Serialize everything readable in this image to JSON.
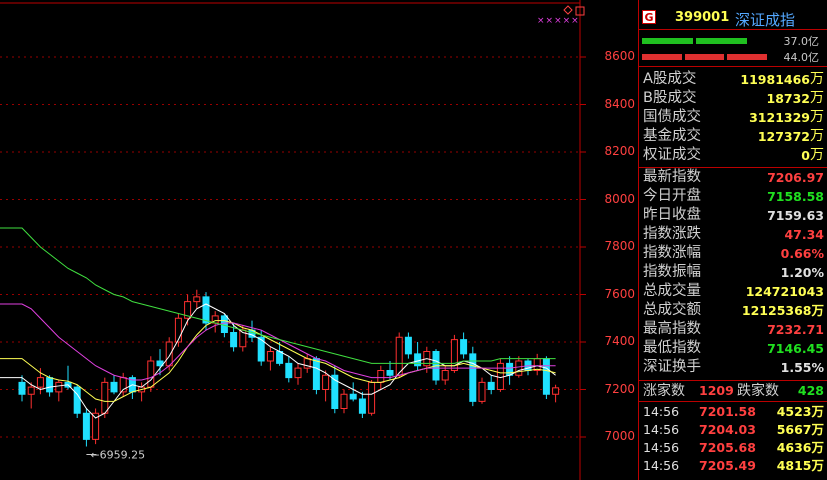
{
  "index": {
    "badge": "G",
    "code": "399001",
    "name": "深证成指"
  },
  "volume_bars": [
    {
      "label": "37.0亿",
      "color": "#20c020",
      "fraction": 0.84
    },
    {
      "label": "44.0亿",
      "color": "#e03030",
      "fraction": 1.0
    }
  ],
  "turnover": [
    {
      "label": "A股成交",
      "value": "11981466",
      "unit": "万"
    },
    {
      "label": "B股成交",
      "value": "18732",
      "unit": "万"
    },
    {
      "label": "国债成交",
      "value": "3121329",
      "unit": "万"
    },
    {
      "label": "基金成交",
      "value": "127372",
      "unit": "万"
    },
    {
      "label": "权证成交",
      "value": "0",
      "unit": "万"
    }
  ],
  "stats": [
    {
      "label": "最新指数",
      "value": "7206.97",
      "color": "r"
    },
    {
      "label": "今日开盘",
      "value": "7158.58",
      "color": "g"
    },
    {
      "label": "昨日收盘",
      "value": "7159.63",
      "color": "w"
    },
    {
      "label": "指数涨跌",
      "value": "47.34",
      "color": "r"
    },
    {
      "label": "指数涨幅",
      "value": "0.66%",
      "color": "r"
    },
    {
      "label": "指数振幅",
      "value": "1.20%",
      "color": "w"
    },
    {
      "label": "总成交量",
      "value": "124721043",
      "color": "y"
    },
    {
      "label": "总成交额",
      "value": "12125368万",
      "color": "y"
    },
    {
      "label": "最高指数",
      "value": "7232.71",
      "color": "r"
    },
    {
      "label": "最低指数",
      "value": "7146.45",
      "color": "g"
    },
    {
      "label": "深证换手",
      "value": "1.55%",
      "color": "w"
    }
  ],
  "breadth": {
    "up_label": "涨家数",
    "up_value": "1209",
    "down_label": "跌家数",
    "down_value": "428"
  },
  "ticks": [
    {
      "time": "14:56",
      "price": "7201.58",
      "vol": "4523万"
    },
    {
      "time": "14:56",
      "price": "7204.03",
      "vol": "5667万"
    },
    {
      "time": "14:56",
      "price": "7205.68",
      "vol": "4636万"
    },
    {
      "time": "14:56",
      "price": "7205.49",
      "vol": "4815万"
    }
  ],
  "chart_data": {
    "type": "candlestick",
    "y_ticks": [
      8600,
      8400,
      8200,
      8000,
      7800,
      7600,
      7400,
      7200,
      7000
    ],
    "ylim": [
      6900,
      8700
    ],
    "min_annotation": "6959.25",
    "stars": "×××××",
    "candles": [
      [
        7230,
        7260,
        7150,
        7180
      ],
      [
        7180,
        7230,
        7120,
        7210
      ],
      [
        7210,
        7290,
        7180,
        7250
      ],
      [
        7250,
        7260,
        7170,
        7190
      ],
      [
        7190,
        7240,
        7150,
        7230
      ],
      [
        7230,
        7300,
        7200,
        7210
      ],
      [
        7210,
        7220,
        7080,
        7100
      ],
      [
        7100,
        7120,
        6960,
        6990
      ],
      [
        6990,
        7120,
        6970,
        7100
      ],
      [
        7100,
        7250,
        7080,
        7230
      ],
      [
        7230,
        7260,
        7180,
        7190
      ],
      [
        7190,
        7270,
        7170,
        7250
      ],
      [
        7250,
        7260,
        7160,
        7190
      ],
      [
        7190,
        7230,
        7150,
        7210
      ],
      [
        7210,
        7340,
        7190,
        7320
      ],
      [
        7320,
        7370,
        7260,
        7300
      ],
      [
        7300,
        7420,
        7280,
        7400
      ],
      [
        7400,
        7520,
        7380,
        7500
      ],
      [
        7500,
        7600,
        7470,
        7570
      ],
      [
        7570,
        7620,
        7540,
        7590
      ],
      [
        7590,
        7610,
        7450,
        7480
      ],
      [
        7480,
        7530,
        7440,
        7510
      ],
      [
        7510,
        7520,
        7420,
        7440
      ],
      [
        7440,
        7480,
        7360,
        7380
      ],
      [
        7380,
        7470,
        7360,
        7450
      ],
      [
        7450,
        7490,
        7400,
        7420
      ],
      [
        7420,
        7450,
        7300,
        7320
      ],
      [
        7320,
        7380,
        7280,
        7360
      ],
      [
        7360,
        7400,
        7300,
        7310
      ],
      [
        7310,
        7340,
        7230,
        7250
      ],
      [
        7250,
        7310,
        7220,
        7290
      ],
      [
        7290,
        7350,
        7270,
        7330
      ],
      [
        7330,
        7340,
        7180,
        7200
      ],
      [
        7200,
        7280,
        7150,
        7260
      ],
      [
        7260,
        7300,
        7100,
        7120
      ],
      [
        7120,
        7200,
        7100,
        7180
      ],
      [
        7180,
        7230,
        7150,
        7160
      ],
      [
        7160,
        7190,
        7080,
        7100
      ],
      [
        7100,
        7240,
        7090,
        7230
      ],
      [
        7230,
        7300,
        7200,
        7280
      ],
      [
        7280,
        7320,
        7240,
        7260
      ],
      [
        7260,
        7440,
        7250,
        7420
      ],
      [
        7420,
        7440,
        7330,
        7350
      ],
      [
        7350,
        7400,
        7280,
        7300
      ],
      [
        7300,
        7380,
        7270,
        7360
      ],
      [
        7360,
        7370,
        7220,
        7240
      ],
      [
        7240,
        7300,
        7220,
        7280
      ],
      [
        7280,
        7430,
        7270,
        7410
      ],
      [
        7410,
        7440,
        7330,
        7350
      ],
      [
        7350,
        7380,
        7130,
        7150
      ],
      [
        7150,
        7250,
        7140,
        7230
      ],
      [
        7230,
        7260,
        7180,
        7200
      ],
      [
        7200,
        7330,
        7190,
        7310
      ],
      [
        7310,
        7340,
        7220,
        7260
      ],
      [
        7260,
        7340,
        7250,
        7320
      ],
      [
        7320,
        7330,
        7260,
        7280
      ],
      [
        7280,
        7350,
        7260,
        7330
      ],
      [
        7330,
        7340,
        7160,
        7180
      ],
      [
        7180,
        7220,
        7146,
        7207
      ]
    ],
    "ma": [
      {
        "color": "#ffffff",
        "values": [
          7250,
          7220,
          7200,
          7210,
          7215,
          7220,
          7180,
          7120,
          7080,
          7100,
          7150,
          7200,
          7220,
          7210,
          7240,
          7290,
          7340,
          7410,
          7490,
          7540,
          7560,
          7540,
          7520,
          7470,
          7440,
          7430,
          7410,
          7380,
          7360,
          7340,
          7310,
          7300,
          7290,
          7270,
          7240,
          7220,
          7200,
          7180,
          7180,
          7200,
          7220,
          7270,
          7310,
          7320,
          7330,
          7320,
          7300,
          7300,
          7320,
          7310,
          7290,
          7260,
          7250,
          7260,
          7280,
          7290,
          7300,
          7290,
          7260
        ]
      },
      {
        "color": "#ffff54",
        "values": [
          7330,
          7300,
          7270,
          7250,
          7240,
          7235,
          7220,
          7190,
          7160,
          7150,
          7150,
          7170,
          7190,
          7200,
          7210,
          7240,
          7270,
          7320,
          7380,
          7430,
          7470,
          7490,
          7490,
          7480,
          7460,
          7450,
          7430,
          7410,
          7390,
          7370,
          7350,
          7330,
          7320,
          7310,
          7290,
          7270,
          7250,
          7240,
          7230,
          7230,
          7240,
          7250,
          7270,
          7280,
          7290,
          7300,
          7300,
          7300,
          7310,
          7300,
          7290,
          7280,
          7270,
          7270,
          7275,
          7280,
          7285,
          7280,
          7270
        ]
      },
      {
        "color": "#e040e0",
        "values": [
          7560,
          7540,
          7500,
          7460,
          7420,
          7390,
          7360,
          7330,
          7300,
          7280,
          7260,
          7250,
          7240,
          7240,
          7250,
          7270,
          7300,
          7340,
          7380,
          7420,
          7450,
          7470,
          7480,
          7480,
          7470,
          7460,
          7450,
          7430,
          7410,
          7390,
          7370,
          7350,
          7330,
          7320,
          7300,
          7280,
          7270,
          7260,
          7250,
          7250,
          7250,
          7260,
          7270,
          7280,
          7290,
          7290,
          7290,
          7290,
          7290,
          7290,
          7290,
          7290,
          7290,
          7290,
          7295,
          7300,
          7300,
          7300,
          7300
        ]
      },
      {
        "color": "#40e040",
        "values": [
          7880,
          7840,
          7800,
          7770,
          7740,
          7710,
          7690,
          7670,
          7640,
          7620,
          7600,
          7590,
          7570,
          7560,
          7550,
          7540,
          7530,
          7520,
          7510,
          7500,
          7490,
          7480,
          7470,
          7460,
          7450,
          7440,
          7430,
          7420,
          7410,
          7400,
          7390,
          7380,
          7370,
          7360,
          7350,
          7340,
          7330,
          7320,
          7310,
          7310,
          7310,
          7310,
          7310,
          7310,
          7310,
          7310,
          7310,
          7310,
          7320,
          7320,
          7320,
          7320,
          7330,
          7330,
          7330,
          7330,
          7330,
          7330,
          7330
        ]
      }
    ]
  }
}
